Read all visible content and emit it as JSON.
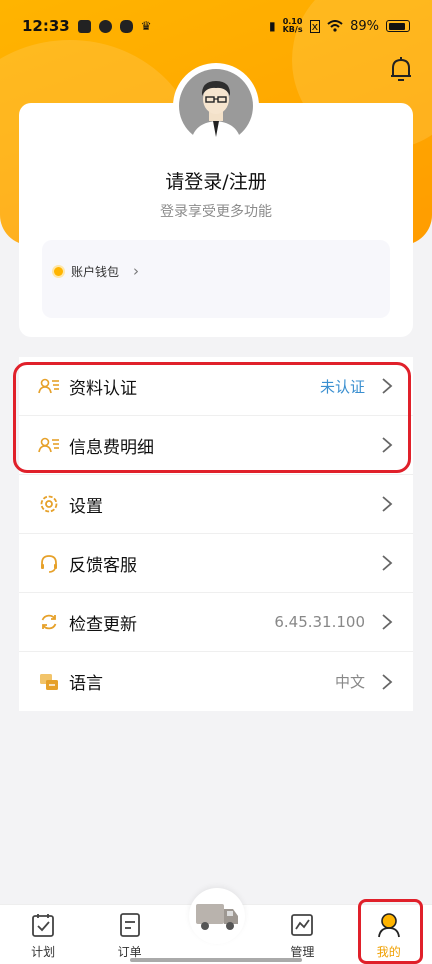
{
  "status_bar": {
    "time": "12:33",
    "net_speed_value": "0.10",
    "net_speed_unit": "KB/s",
    "battery": "89%"
  },
  "profile": {
    "login_title": "请登录/注册",
    "login_subtitle": "登录享受更多功能",
    "wallet_label": "账户钱包"
  },
  "menu": [
    {
      "label": "资料认证",
      "value": "未认证",
      "icon": "id-card-icon"
    },
    {
      "label": "信息费明细",
      "value": "",
      "icon": "id-card-icon"
    },
    {
      "label": "设置",
      "value": "",
      "icon": "gear-icon"
    },
    {
      "label": "反馈客服",
      "value": "",
      "icon": "headset-icon"
    },
    {
      "label": "检查更新",
      "value": "6.45.31.100",
      "icon": "refresh-icon"
    },
    {
      "label": "语言",
      "value": "中文",
      "icon": "language-icon"
    }
  ],
  "tabs": [
    {
      "label": "计划",
      "icon": "plan-icon"
    },
    {
      "label": "订单",
      "icon": "order-icon"
    },
    {
      "label": "管理",
      "icon": "chart-icon"
    },
    {
      "label": "我的",
      "icon": "profile-icon"
    }
  ],
  "colors": {
    "accent": "#ffb400",
    "highlight_border": "#e0202a",
    "link_blue": "#3a8fd0"
  }
}
